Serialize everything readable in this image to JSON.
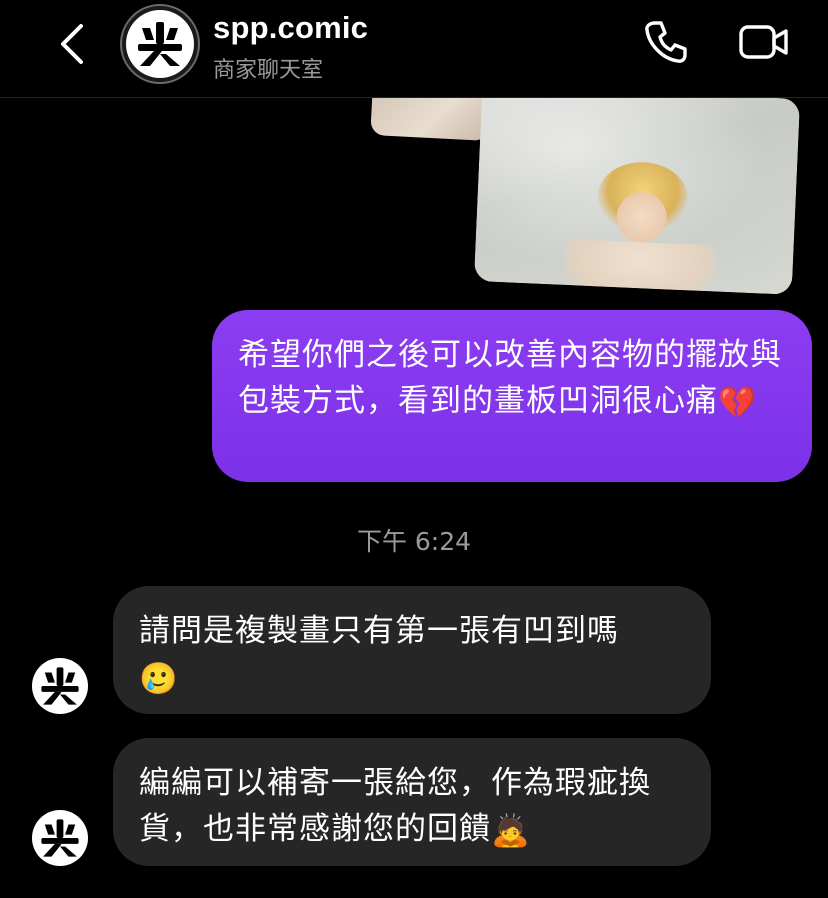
{
  "header": {
    "name": "spp.comic",
    "subtitle": "商家聊天室",
    "avatar_text": "尖"
  },
  "shared_image": {
    "description_icon": "photo"
  },
  "messages": [
    {
      "direction": "outgoing",
      "text": "希望你們之後可以改善內容物的擺放與包裝方式，看到的畫板凹洞很心痛",
      "emoji": "💔"
    },
    {
      "type": "timestamp",
      "text": "下午 6:24"
    },
    {
      "direction": "incoming",
      "text": "請問是複製畫只有第一張有凹到嗎",
      "emoji": "🥲"
    },
    {
      "direction": "incoming",
      "text": "編編可以補寄一張給您，作為瑕疵換貨，也非常感謝您的回饋",
      "emoji": "🙇"
    }
  ],
  "colors": {
    "outgoing_bubble": "#7b31e8",
    "incoming_bubble": "#262626",
    "background": "#000000",
    "subtitle": "#9a9a9a"
  },
  "icons": [
    "chevron-left-icon",
    "phone-icon",
    "video-camera-icon"
  ]
}
